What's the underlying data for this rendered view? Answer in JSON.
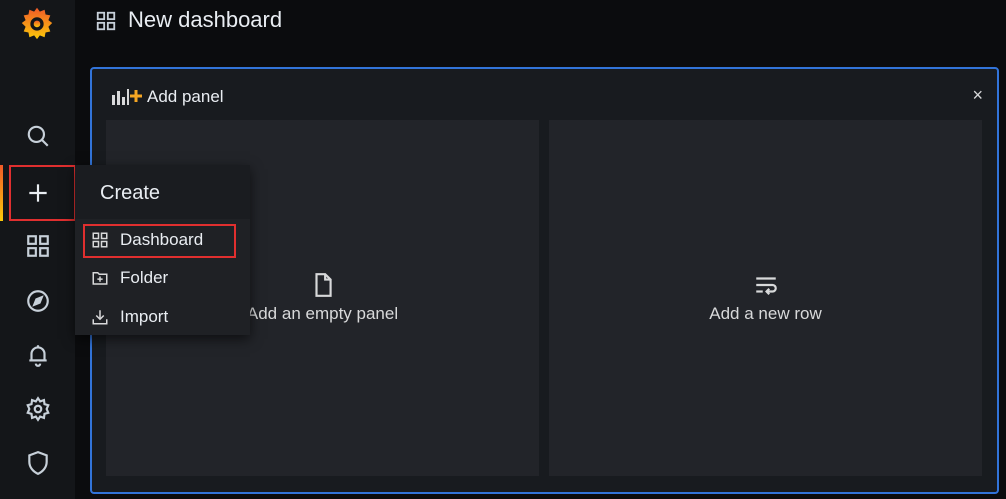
{
  "header": {
    "title": "New dashboard",
    "icon": "dashboard-grid-icon"
  },
  "sidebar": {
    "items": [
      {
        "icon": "search-icon"
      },
      {
        "icon": "plus-icon",
        "active": true
      },
      {
        "icon": "dashboards-icon"
      },
      {
        "icon": "explore-compass-icon"
      },
      {
        "icon": "alerting-bell-icon"
      },
      {
        "icon": "gear-icon"
      },
      {
        "icon": "shield-icon"
      }
    ]
  },
  "create_menu": {
    "title": "Create",
    "items": [
      {
        "label": "Dashboard",
        "icon": "dashboard-grid-icon",
        "highlighted": true
      },
      {
        "label": "Folder",
        "icon": "folder-plus-icon"
      },
      {
        "label": "Import",
        "icon": "import-icon"
      }
    ]
  },
  "add_panel": {
    "title": "Add panel",
    "close_label": "×",
    "options": [
      {
        "label": "Add an empty panel",
        "icon": "file-icon"
      },
      {
        "label": "Add a new row",
        "icon": "new-row-icon"
      }
    ]
  },
  "colors": {
    "accent_blue": "#3274d9",
    "highlight_red": "#e02f2f",
    "brand_orange": "#f05a28",
    "brand_yellow": "#fbca0a"
  }
}
